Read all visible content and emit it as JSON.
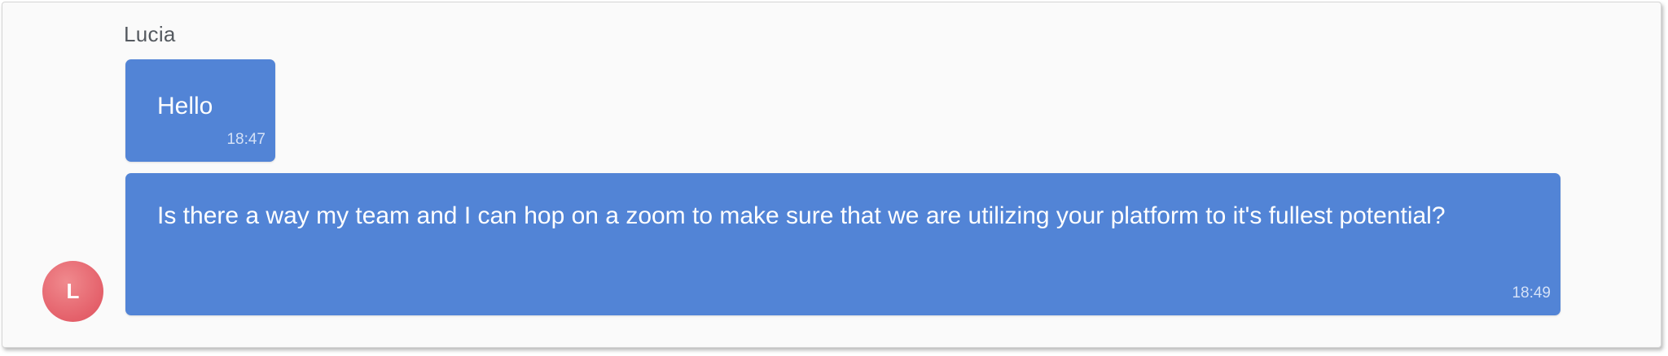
{
  "conversation": {
    "sender_name": "Lucia",
    "avatar_initial": "L",
    "avatar_color": "#e4606a",
    "bubble_color": "#5284d6",
    "messages": [
      {
        "text": "Hello",
        "time": "18:47"
      },
      {
        "text": "Is there a way my team and I can hop on a zoom to make sure that we are utilizing your platform to it's fullest potential?",
        "time": "18:49"
      }
    ]
  }
}
